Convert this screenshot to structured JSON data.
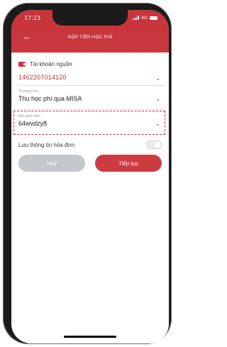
{
  "status_bar": {
    "time": "17:23",
    "network": "4G"
  },
  "header": {
    "title": "NỘP TIỀN HỌC PHÍ",
    "back_icon": "arrow-left-icon"
  },
  "source_account": {
    "label": "Tài khoản nguồn",
    "value": "1462207014120"
  },
  "school": {
    "label": "Trường học",
    "value": "Thu học phí qua MISA"
  },
  "student_id": {
    "label": "Mã sinh viên",
    "value": "64wvdzy8"
  },
  "save_invoice": {
    "label": "Lưu thông tin hóa đơn",
    "enabled": false
  },
  "buttons": {
    "cancel": "Huỷ",
    "continue": "Tiếp tục"
  },
  "colors": {
    "brand": "#c7333b",
    "cancel_button": "#c4c7cc",
    "highlight_dashed": "#e0262d"
  }
}
